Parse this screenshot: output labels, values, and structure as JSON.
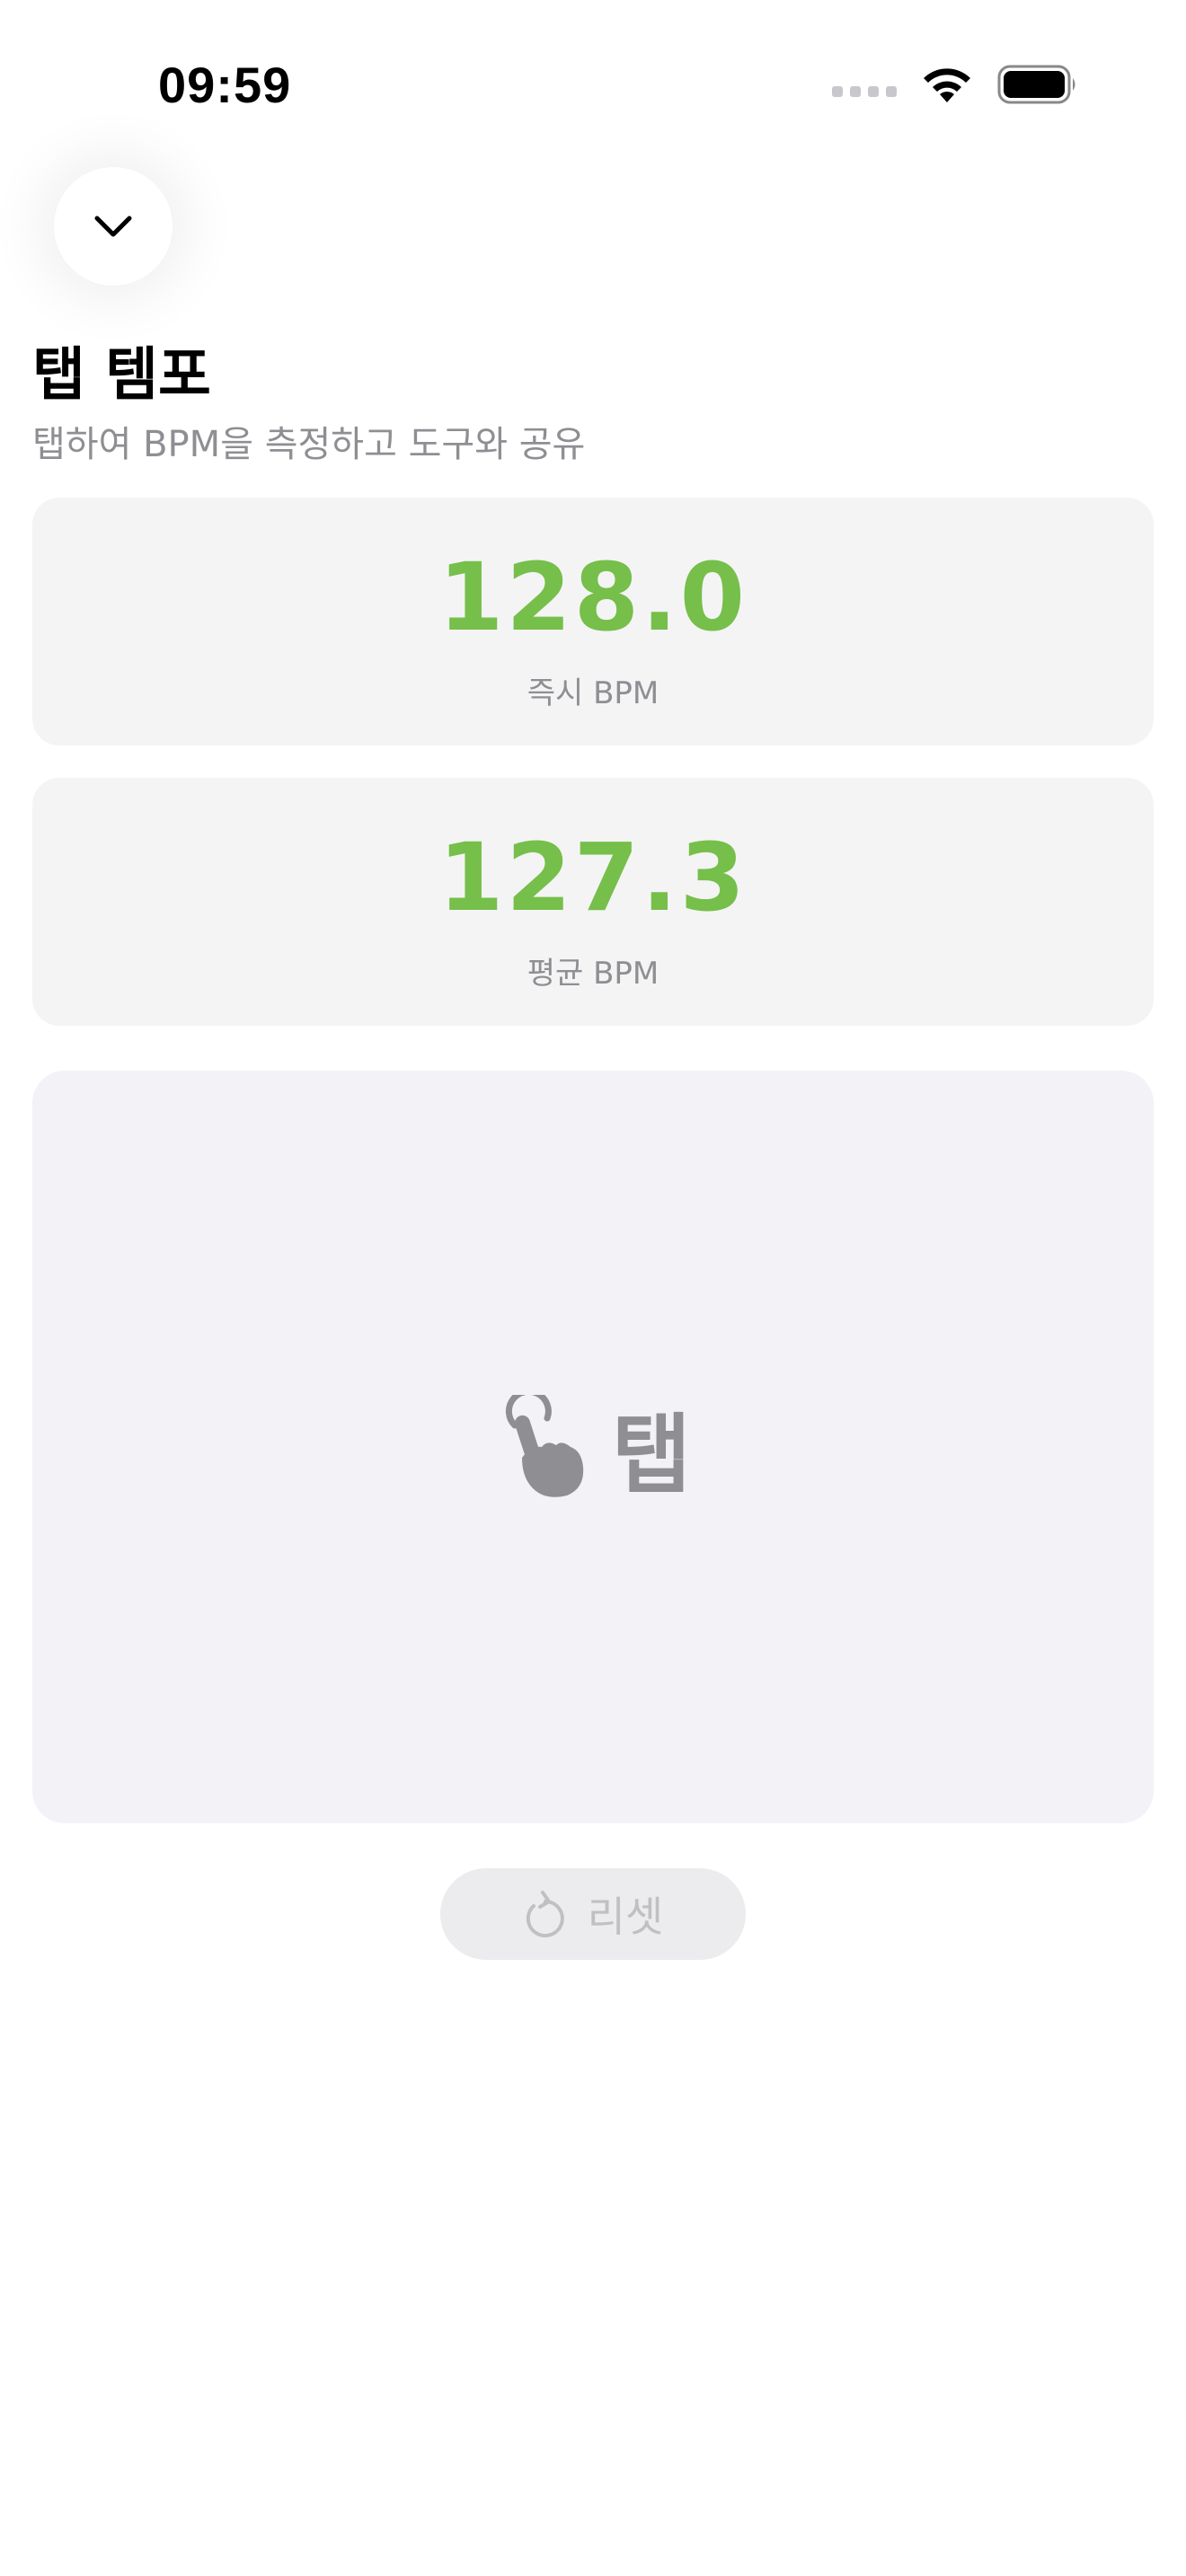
{
  "status_bar": {
    "time": "09:59"
  },
  "header": {
    "title": "탭 템포",
    "subtitle": "탭하여 BPM을 측정하고 도구와 공유"
  },
  "metrics": {
    "instant": {
      "value": "128.0",
      "label": "즉시 BPM"
    },
    "average": {
      "value": "127.3",
      "label": "평균 BPM"
    }
  },
  "tap_area": {
    "label": "탭",
    "icon": "hand-tap-icon"
  },
  "reset_button": {
    "label": "리셋",
    "icon": "reset-arrow-icon"
  },
  "colors": {
    "accent_green": "#76bf4a",
    "secondary_text": "#8e8e93",
    "card_bg": "#f4f4f5"
  }
}
